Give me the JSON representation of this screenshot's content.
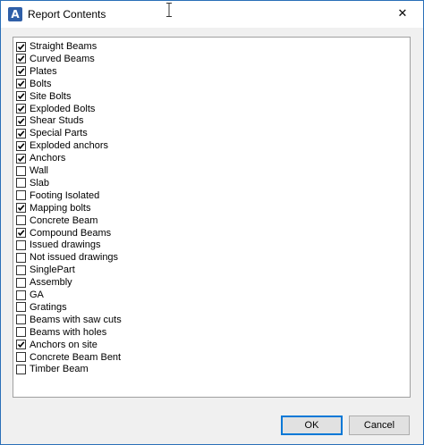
{
  "window": {
    "title": "Report Contents",
    "app_icon": "A",
    "close_glyph": "✕"
  },
  "list": {
    "items": [
      {
        "label": "Straight Beams",
        "checked": true
      },
      {
        "label": "Curved Beams",
        "checked": true
      },
      {
        "label": "Plates",
        "checked": true
      },
      {
        "label": "Bolts",
        "checked": true
      },
      {
        "label": "Site Bolts",
        "checked": true
      },
      {
        "label": "Exploded Bolts",
        "checked": true
      },
      {
        "label": "Shear Studs",
        "checked": true
      },
      {
        "label": "Special Parts",
        "checked": true
      },
      {
        "label": "Exploded anchors",
        "checked": true
      },
      {
        "label": "Anchors",
        "checked": true
      },
      {
        "label": "Wall",
        "checked": false
      },
      {
        "label": "Slab",
        "checked": false
      },
      {
        "label": "Footing Isolated",
        "checked": false
      },
      {
        "label": "Mapping bolts",
        "checked": true
      },
      {
        "label": "Concrete Beam",
        "checked": false
      },
      {
        "label": "Compound Beams",
        "checked": true
      },
      {
        "label": "Issued drawings",
        "checked": false
      },
      {
        "label": "Not issued drawings",
        "checked": false
      },
      {
        "label": "SinglePart",
        "checked": false
      },
      {
        "label": "Assembly",
        "checked": false
      },
      {
        "label": "GA",
        "checked": false
      },
      {
        "label": "Gratings",
        "checked": false
      },
      {
        "label": "Beams with saw cuts",
        "checked": false
      },
      {
        "label": "Beams with holes",
        "checked": false
      },
      {
        "label": "Anchors on site",
        "checked": true
      },
      {
        "label": "Concrete Beam Bent",
        "checked": false
      },
      {
        "label": "Timber Beam",
        "checked": false
      }
    ]
  },
  "buttons": {
    "ok_label": "OK",
    "cancel_label": "Cancel"
  }
}
